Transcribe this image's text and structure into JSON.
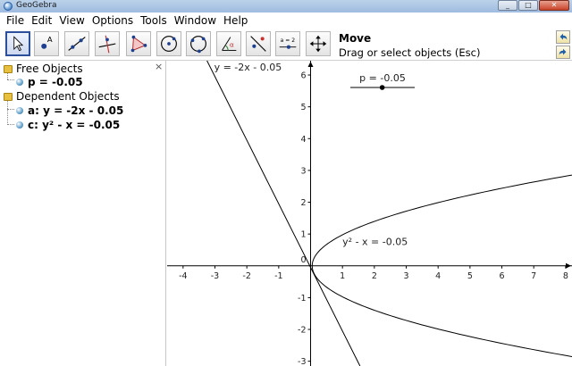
{
  "window": {
    "title": "GeoGebra",
    "minimize": "_",
    "maximize": "□",
    "close": "✕"
  },
  "menu": [
    "File",
    "Edit",
    "View",
    "Options",
    "Tools",
    "Window",
    "Help"
  ],
  "toolbar": {
    "tools": [
      {
        "name": "move-tool-button",
        "icon": "arrow-pointer-icon",
        "selected": true
      },
      {
        "name": "point-tool-button",
        "icon": "point-a-icon"
      },
      {
        "name": "line-tool-button",
        "icon": "line-through-points-icon"
      },
      {
        "name": "perpendicular-tool-button",
        "icon": "perpendicular-line-icon"
      },
      {
        "name": "polygon-tool-button",
        "icon": "polygon-icon"
      },
      {
        "name": "circle-tool-button",
        "icon": "circle-center-point-icon"
      },
      {
        "name": "circle-three-points-tool-button",
        "icon": "circle-three-points-icon"
      },
      {
        "name": "angle-tool-button",
        "icon": "angle-icon"
      },
      {
        "name": "reflect-tool-button",
        "icon": "reflect-icon"
      },
      {
        "name": "slider-tool-button",
        "icon": "slider-icon",
        "text": "a = 2"
      },
      {
        "name": "move-view-tool-button",
        "icon": "move-graphics-view-icon"
      }
    ],
    "active_tool_title": "Move",
    "active_tool_help": "Drag or select objects (Esc)",
    "undo_icon": "undo-icon",
    "redo_icon": "redo-icon"
  },
  "algebra": {
    "close_glyph": "×",
    "free_folder": "Free Objects",
    "free_items": [
      "p = -0.05"
    ],
    "dependent_folder": "Dependent Objects",
    "dependent_items": [
      "a: y = -2x - 0.05",
      "c: y² - x = -0.05"
    ]
  },
  "graphics": {
    "x_range": [
      -4.5,
      8.2
    ],
    "y_range": [
      -3.15,
      6.45
    ],
    "x_ticks": [
      -4,
      -3,
      -2,
      -1,
      1,
      2,
      3,
      4,
      5,
      6,
      7,
      8
    ],
    "y_ticks": [
      -3,
      -2,
      -1,
      1,
      2,
      3,
      4,
      5,
      6
    ],
    "origin_label": "0",
    "line": {
      "slope": -2,
      "intercept": -0.05,
      "label": "y = -2x - 0.05"
    },
    "parabola": {
      "constant": -0.05,
      "label": "y² - x = -0.05"
    },
    "slider": {
      "label": "p = -0.05",
      "min": -5,
      "max": 5,
      "value": -0.05
    },
    "colors": {
      "curve": "#000000",
      "axis": "#000000"
    }
  }
}
